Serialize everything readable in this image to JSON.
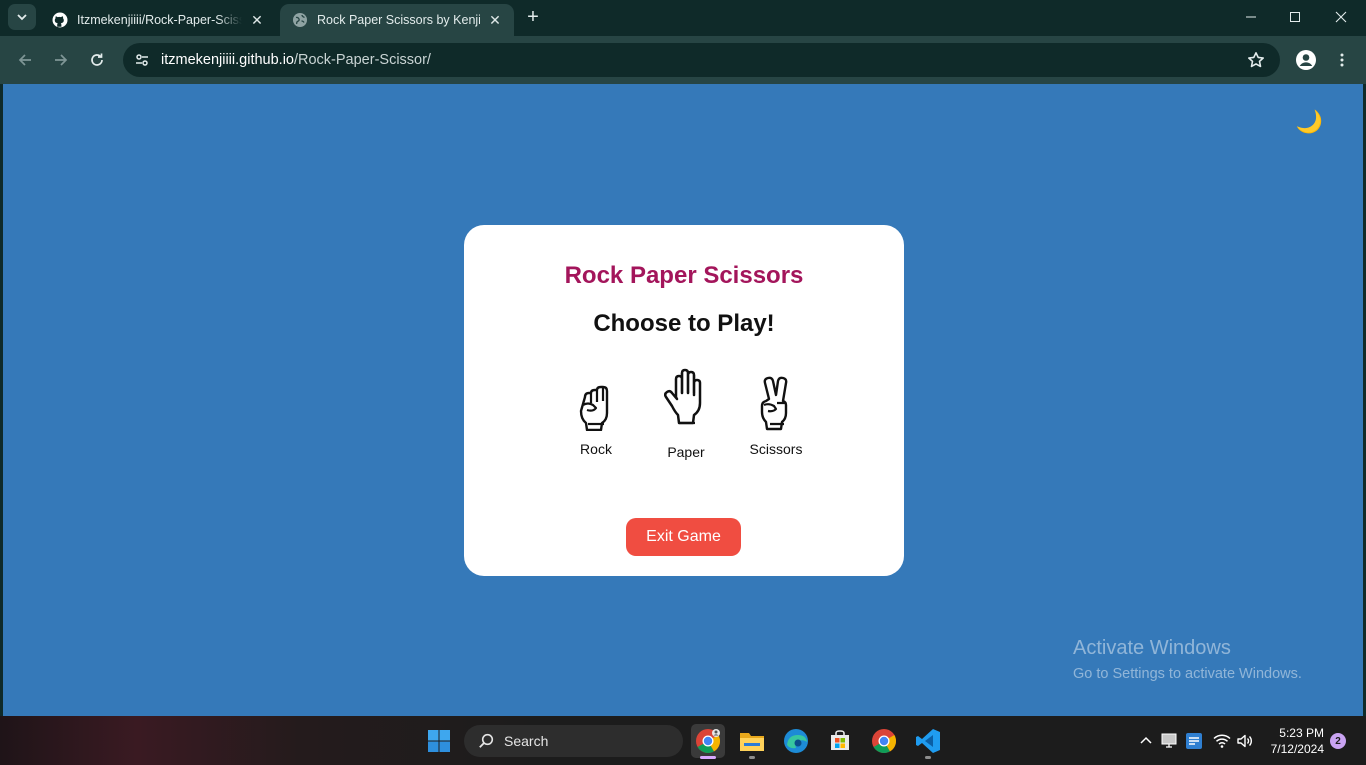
{
  "browser": {
    "tabs": [
      {
        "title": "Itzmekenjiiii/Rock-Paper-Scissors",
        "favicon": "github-icon",
        "active": false
      },
      {
        "title": "Rock Paper Scissors by Kenji",
        "favicon": "globe-icon",
        "active": true
      }
    ],
    "url_host": "itzmekenjiiii.github.io",
    "url_path": "/Rock-Paper-Scissor/"
  },
  "page": {
    "theme_toggle_icon": "🌙",
    "app_title": "Rock Paper Scissors",
    "prompt": "Choose to Play!",
    "choices": [
      {
        "label": "Rock",
        "icon": "fist-icon"
      },
      {
        "label": "Paper",
        "icon": "open-hand-icon"
      },
      {
        "label": "Scissors",
        "icon": "victory-hand-icon"
      }
    ],
    "exit_label": "Exit Game",
    "colors": {
      "background": "#3579b9",
      "title": "#a3155b",
      "exit_button": "#f04d41"
    }
  },
  "watermark": {
    "line1": "Activate Windows",
    "line2": "Go to Settings to activate Windows."
  },
  "taskbar": {
    "search_placeholder": "Search",
    "time": "5:23 PM",
    "date": "7/12/2024",
    "notification_count": "2"
  }
}
